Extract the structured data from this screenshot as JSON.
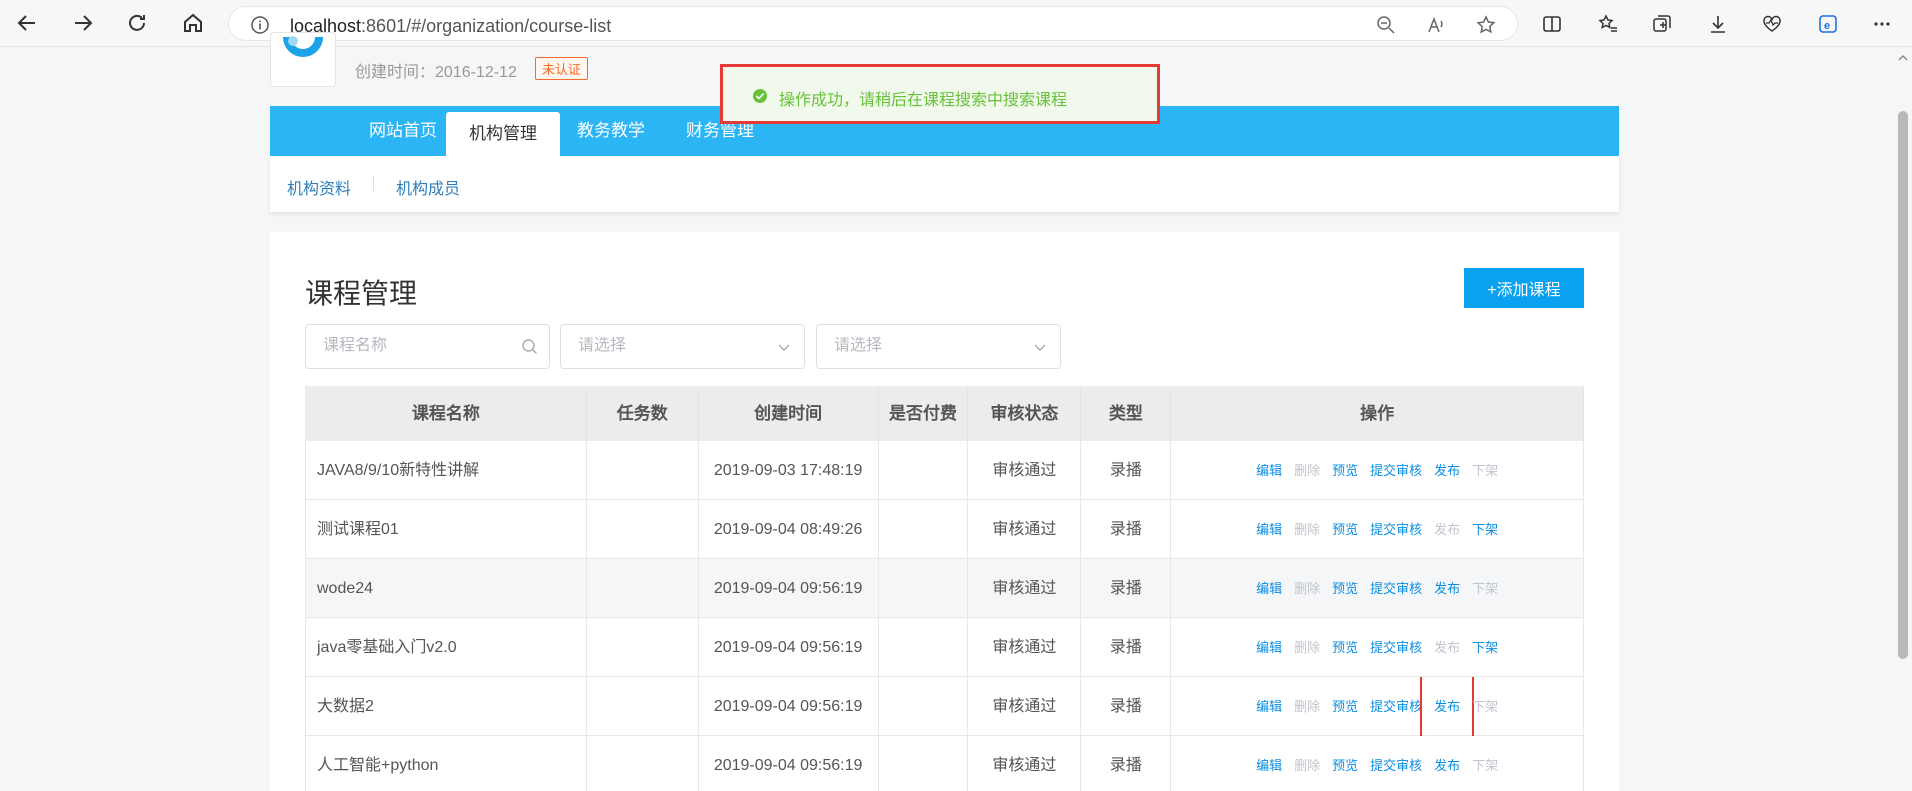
{
  "browser": {
    "url_host": "localhost",
    "url_rest": ":8601/#/organization/course-list"
  },
  "header": {
    "created_label": "创建时间：2016-12-12",
    "cert_badge": "未认证"
  },
  "topnav": {
    "items": [
      {
        "label": "网站首页"
      },
      {
        "label": "机构管理"
      },
      {
        "label": "教务教学"
      },
      {
        "label": "财务管理"
      }
    ],
    "active": "机构管理"
  },
  "subnav": {
    "items": [
      {
        "label": "机构资料"
      },
      {
        "label": "机构成员"
      }
    ]
  },
  "toast": {
    "message": "操作成功，请稍后在课程搜索中搜索课程"
  },
  "main": {
    "title": "课程管理",
    "add_button": "+添加课程",
    "search_placeholder": "课程名称",
    "select1_placeholder": "请选择",
    "select2_placeholder": "请选择"
  },
  "table": {
    "columns": [
      "课程名称",
      "任务数",
      "创建时间",
      "是否付费",
      "审核状态",
      "类型",
      "操作"
    ],
    "op_labels": [
      "编辑",
      "删除",
      "预览",
      "提交审核",
      "发布",
      "下架"
    ],
    "rows": [
      {
        "name": "JAVA8/9/10新特性讲解",
        "tasks": "",
        "created": "2019-09-03 17:48:19",
        "paid": "",
        "status": "审核通过",
        "type": "录播",
        "publish_enabled": true,
        "offline_enabled": false
      },
      {
        "name": "测试课程01",
        "tasks": "",
        "created": "2019-09-04 08:49:26",
        "paid": "",
        "status": "审核通过",
        "type": "录播",
        "publish_enabled": false,
        "offline_enabled": true
      },
      {
        "name": "wode24",
        "tasks": "",
        "created": "2019-09-04 09:56:19",
        "paid": "",
        "status": "审核通过",
        "type": "录播",
        "publish_enabled": true,
        "offline_enabled": false
      },
      {
        "name": "java零基础入门v2.0",
        "tasks": "",
        "created": "2019-09-04 09:56:19",
        "paid": "",
        "status": "审核通过",
        "type": "录播",
        "publish_enabled": false,
        "offline_enabled": true
      },
      {
        "name": "大数据2",
        "tasks": "",
        "created": "2019-09-04 09:56:19",
        "paid": "",
        "status": "审核通过",
        "type": "录播",
        "publish_enabled": true,
        "offline_enabled": false,
        "highlight_publish": true
      },
      {
        "name": "人工智能+python",
        "tasks": "",
        "created": "2019-09-04 09:56:19",
        "paid": "",
        "status": "审核通过",
        "type": "录播",
        "publish_enabled": true,
        "offline_enabled": false
      }
    ]
  },
  "colors": {
    "nav_blue": "#2cb5f5",
    "link_blue": "#0a8ee0",
    "success_green": "#67c23a",
    "highlight_red": "#e53935"
  }
}
